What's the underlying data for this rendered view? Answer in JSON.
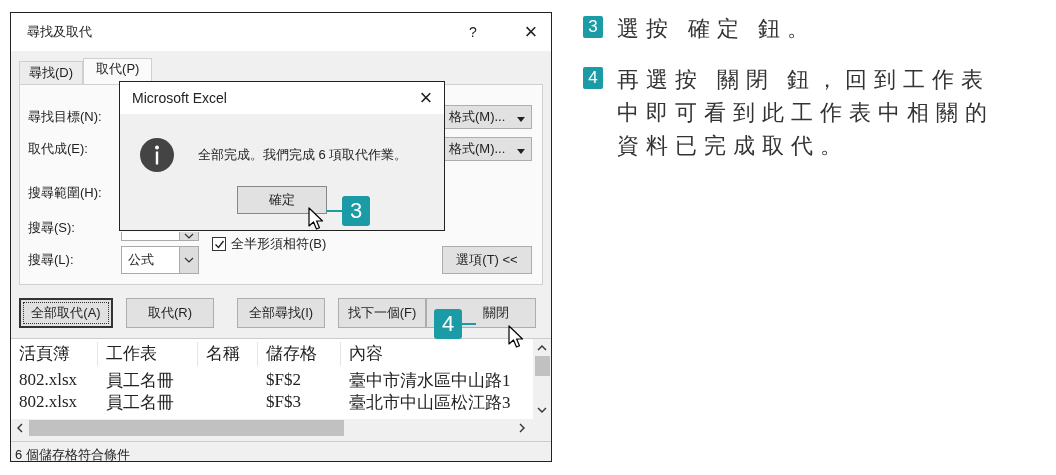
{
  "dialog": {
    "title": "尋找及取代",
    "help": "?",
    "close": "×",
    "tabs": [
      {
        "label": "尋找(D)",
        "selected": false
      },
      {
        "label": "取代(P)",
        "selected": true
      }
    ],
    "rows": [
      {
        "label": "尋找目標(N):",
        "format_button": "格式(M)..."
      },
      {
        "label": "取代成(E):",
        "format_button": "格式(M)..."
      },
      {
        "label": "搜尋範圍(H):"
      },
      {
        "label": "搜尋(S):",
        "kind": "dropdown"
      },
      {
        "label": "搜尋(L):",
        "kind": "dropdown",
        "value": "公式"
      }
    ],
    "checkbox": {
      "label": "全半形須相符(B)",
      "checked": true
    },
    "options_button": "選項(T) <<",
    "buttons": [
      {
        "label": "全部取代(A)",
        "default": true
      },
      {
        "label": "取代(R)",
        "default": false
      },
      {
        "label": "全部尋找(I)",
        "default": false
      },
      {
        "label": "找下一個(F)",
        "default": false
      },
      {
        "label": "關閉",
        "default": false
      }
    ],
    "results": {
      "columns": [
        "活頁簿",
        "工作表",
        "名稱",
        "儲存格",
        "內容"
      ],
      "rows": [
        [
          "802.xlsx",
          "員工名冊",
          "",
          "$F$2",
          "臺中市清水區中山路1"
        ],
        [
          "802.xlsx",
          "員工名冊",
          "",
          "$F$3",
          "臺北市中山區松江路3"
        ]
      ]
    },
    "status": "6 個儲存格符合條件"
  },
  "message_box": {
    "title": "Microsoft Excel",
    "close": "×",
    "message": "全部完成。我們完成 6 項取代作業。",
    "button": "確定"
  },
  "callouts": [
    {
      "number": "3"
    },
    {
      "number": "4"
    }
  ],
  "steps": [
    {
      "number": "3",
      "text": "選按 確定 鈕。"
    },
    {
      "number": "4",
      "text": "再選按 關閉 鈕，回到工作表中即可看到此工作表中相關的資料已完成取代。"
    }
  ]
}
